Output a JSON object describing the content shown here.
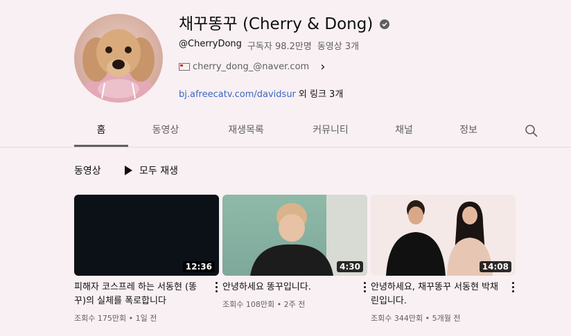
{
  "channel": {
    "name": "채꾸똥꾸 (Cherry & Dong)",
    "handle": "@CherryDong",
    "subscribers": "구독자 98.2만명",
    "video_count": "동영상 3개",
    "email": "cherry_dong_@naver.com",
    "link": "bj.afreecatv.com/davidsur",
    "more_links": "외 링크 3개"
  },
  "tabs": [
    {
      "label": "홈",
      "active": true
    },
    {
      "label": "동영상",
      "active": false
    },
    {
      "label": "재생목록",
      "active": false
    },
    {
      "label": "커뮤니티",
      "active": false
    },
    {
      "label": "채널",
      "active": false
    },
    {
      "label": "정보",
      "active": false
    }
  ],
  "section": {
    "title": "동영상",
    "play_all": "모두 재생"
  },
  "videos": [
    {
      "title": "피해자 코스프레 하는 서동현 (똥꾸)의 실체를 폭로합니다",
      "duration": "12:36",
      "views": "조회수 175만회",
      "age": "1일 전"
    },
    {
      "title": "안녕하세요 똥꾸입니다.",
      "duration": "4:30",
      "views": "조회수 108만회",
      "age": "2주 전"
    },
    {
      "title": "안녕하세요, 채꾸똥꾸 서동현 박채린입니다.",
      "duration": "14:08",
      "views": "조회수 344만회",
      "age": "5개월 전"
    }
  ],
  "icons": {
    "verified": "verified-check-icon",
    "email": "email-icon",
    "chevron": "chevron-right-icon",
    "search": "search-icon",
    "play": "play-icon",
    "more": "more-vert-icon"
  },
  "colors": {
    "background": "#f9f0f3",
    "link": "#3a66c4",
    "secondary_text": "#606060"
  }
}
